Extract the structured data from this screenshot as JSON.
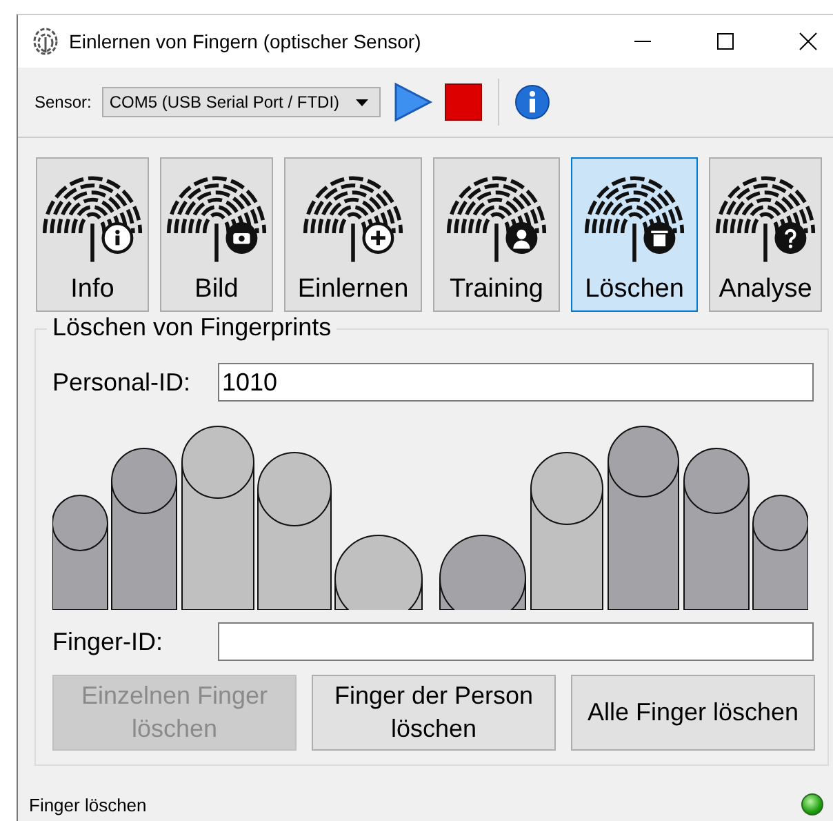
{
  "window": {
    "title": "Einlernen von Fingern (optischer Sensor)"
  },
  "toolbar": {
    "sensor_label": "Sensor:",
    "sensor_value": "COM5 (USB Serial Port / FTDI)"
  },
  "tabs": [
    {
      "label": "Info",
      "selected": false
    },
    {
      "label": "Bild",
      "selected": false
    },
    {
      "label": "Einlernen",
      "selected": false
    },
    {
      "label": "Training",
      "selected": false
    },
    {
      "label": "Löschen",
      "selected": true
    },
    {
      "label": "Analyse",
      "selected": false
    }
  ],
  "group": {
    "title": "Löschen von Fingerprints",
    "personal_id": {
      "label": "Personal-ID:",
      "value": "1010"
    },
    "fingers": [
      {
        "highlighted": false
      },
      {
        "highlighted": false
      },
      {
        "highlighted": true
      },
      {
        "highlighted": true
      },
      {
        "highlighted": true
      },
      {
        "highlighted": false
      },
      {
        "highlighted": true
      },
      {
        "highlighted": false
      },
      {
        "highlighted": false
      },
      {
        "highlighted": false
      }
    ],
    "finger_id": {
      "label": "Finger-ID:"
    },
    "buttons": [
      {
        "label": "Einzelnen Finger löschen",
        "disabled": true
      },
      {
        "label": "Finger der Person löschen",
        "disabled": false
      },
      {
        "label": "Alle Finger löschen",
        "disabled": false
      }
    ]
  },
  "status_bar": {
    "text": "Finger löschen",
    "connected": true
  }
}
